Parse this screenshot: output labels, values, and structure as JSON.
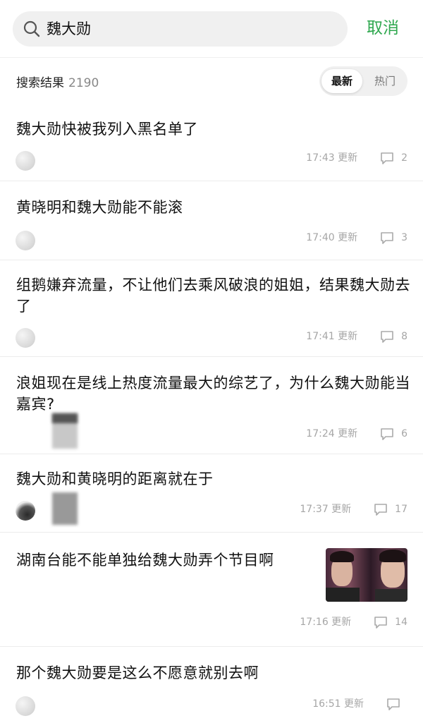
{
  "search": {
    "query": "魏大勋",
    "cancel_label": "取消"
  },
  "results": {
    "label": "搜索结果",
    "count": "2190",
    "sort_options": [
      "最新",
      "热门"
    ]
  },
  "items": [
    {
      "title": "魏大勋快被我列入黑名单了",
      "time": "17:43 更新",
      "comments": "2"
    },
    {
      "title": "黄晓明和魏大勋能不能滚",
      "time": "17:40 更新",
      "comments": "3"
    },
    {
      "title": "组鹅嫌弃流量，不让他们去乘风破浪的姐姐，结果魏大勋去了",
      "time": "17:41 更新",
      "comments": "8"
    },
    {
      "title": "浪姐现在是线上热度流量最大的综艺了，为什么魏大勋能当嘉宾?",
      "time": "17:24 更新",
      "comments": "6"
    },
    {
      "title": "魏大勋和黄晓明的距离就在于",
      "time": "17:37 更新",
      "comments": "17"
    },
    {
      "title": "湖南台能不能单独给魏大勋弄个节目啊",
      "time": "17:16 更新",
      "comments": "14"
    },
    {
      "title": "那个魏大勋要是这么不愿意就别去啊",
      "time": "16:51 更新",
      "comments": ""
    }
  ],
  "colors": {
    "accent": "#2fa84f",
    "muted": "#a6a6a6"
  }
}
